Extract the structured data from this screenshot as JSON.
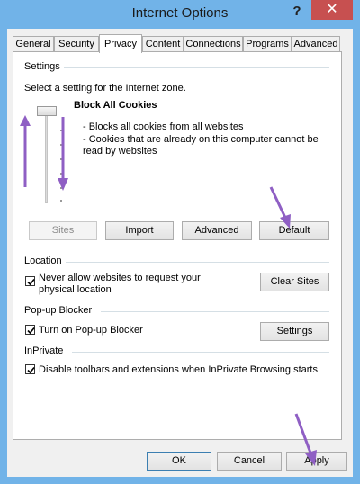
{
  "window": {
    "title": "Internet Options",
    "help_label": "?",
    "close_label": "✕"
  },
  "tabs": [
    {
      "label": "General"
    },
    {
      "label": "Security"
    },
    {
      "label": "Privacy"
    },
    {
      "label": "Content"
    },
    {
      "label": "Connections"
    },
    {
      "label": "Programs"
    },
    {
      "label": "Advanced"
    }
  ],
  "active_tab": "Privacy",
  "settings": {
    "group_label": "Settings",
    "prompt": "Select a setting for the Internet zone.",
    "level_title": "Block All Cookies",
    "description_1": "- Blocks all cookies from all websites",
    "description_2": "- Cookies that are already on this computer cannot be",
    "description_3": "read by websites",
    "buttons": {
      "sites": "Sites",
      "import": "Import",
      "advanced": "Advanced",
      "default": "Default"
    }
  },
  "location": {
    "group_label": "Location",
    "checkbox_label_1": "Never allow websites to request your",
    "checkbox_label_2": "physical location",
    "checked": true,
    "clear_sites": "Clear Sites"
  },
  "popup": {
    "group_label": "Pop-up Blocker",
    "checkbox_label": "Turn on Pop-up Blocker",
    "checked": true,
    "settings_button": "Settings"
  },
  "inprivate": {
    "group_label": "InPrivate",
    "checkbox_label": "Disable toolbars and extensions when InPrivate Browsing starts",
    "checked": true
  },
  "footer": {
    "ok": "OK",
    "cancel": "Cancel",
    "apply": "Apply"
  },
  "colors": {
    "titlebar": "#71b3e8",
    "close": "#c75050",
    "annotation_arrow": "#8f5fc4"
  }
}
